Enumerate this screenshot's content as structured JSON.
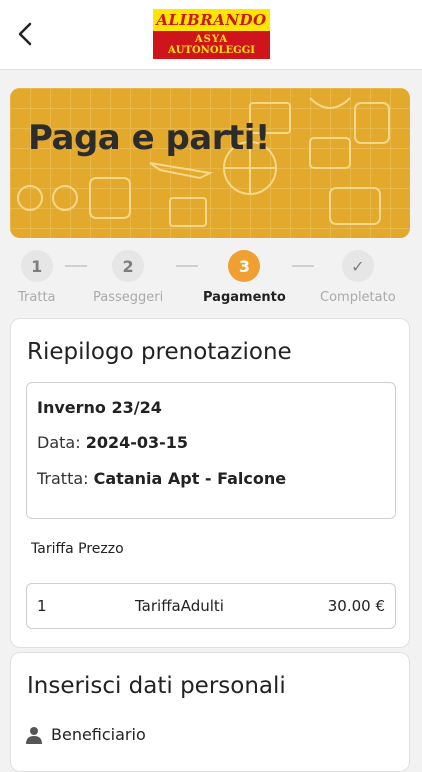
{
  "header": {
    "logo_line1": "ALIBRANDO",
    "logo_line2": "ASYA",
    "logo_line3": "AUTONOLEGGI"
  },
  "banner": {
    "title": "Paga e parti!"
  },
  "steps": [
    {
      "number": "1",
      "label": "Tratta",
      "state": "done"
    },
    {
      "number": "2",
      "label": "Passeggeri",
      "state": "done"
    },
    {
      "number": "3",
      "label": "Pagamento",
      "state": "active"
    },
    {
      "number": "✓",
      "label": "Completato",
      "state": "pending"
    }
  ],
  "summary": {
    "title": "Riepilogo prenotazione",
    "season": "Inverno 23/24",
    "date_label": "Data:",
    "date_value": "2024-03-15",
    "route_label": "Tratta:",
    "route_value": "Catania Apt - Falcone",
    "tariff_header": "Tariffa Prezzo",
    "tariff_row": {
      "qty": "1",
      "name": "TariffaAdulti",
      "price": "30.00 €"
    }
  },
  "personal": {
    "title": "Inserisci dati personali",
    "beneficiary_label": "Beneficiario"
  },
  "icons": {
    "back": "chevron-left-icon",
    "user": "user-icon",
    "check": "check-icon"
  },
  "colors": {
    "accent": "#f0a030",
    "banner": "#e2a92c",
    "logo_yellow": "#ffe600",
    "logo_red": "#d0141b"
  }
}
